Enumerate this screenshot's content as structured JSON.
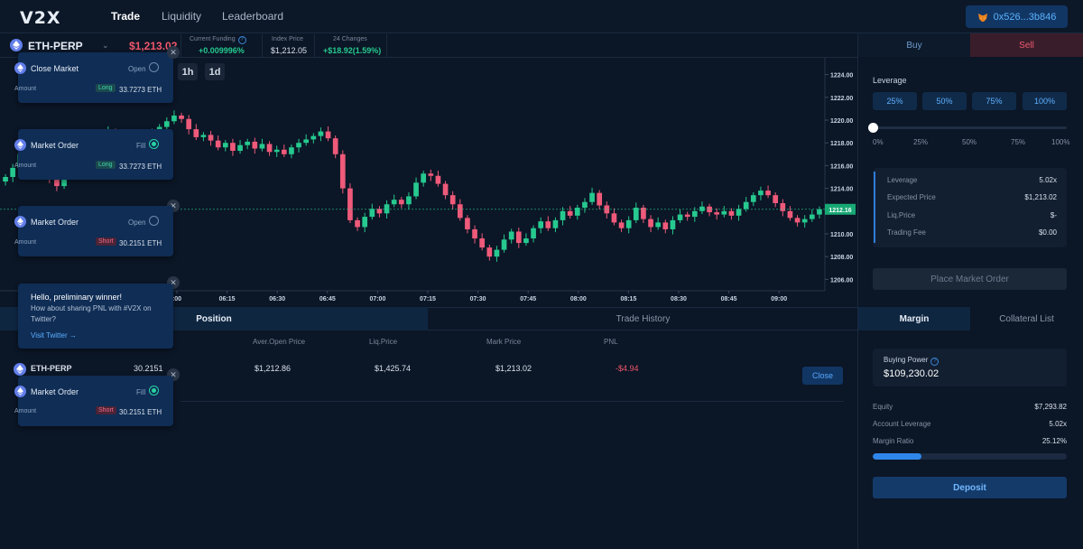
{
  "nav": {
    "logo": "V2X",
    "links": [
      "Trade",
      "Liquidity",
      "Leaderboard"
    ],
    "wallet": "0x526...3b846"
  },
  "ticker": {
    "pair": "ETH-PERP",
    "last_price": "$1,213.02",
    "funding_label": "Current Funding",
    "funding_value": "+0.009996%",
    "index_label": "Index Price",
    "index_value": "$1,212.05",
    "change_label": "24 Changes",
    "change_value": "+$18.92(1.59%)"
  },
  "timeframes": [
    "1h",
    "1d"
  ],
  "chart_data": {
    "type": "candlestick",
    "y_ticks": [
      "1224.00",
      "1222.00",
      "1220.00",
      "1218.00",
      "1216.00",
      "1214.00",
      "1212.00",
      "1210.00",
      "1208.00",
      "1206.00"
    ],
    "x_ticks": [
      ":00",
      "06:15",
      "06:30",
      "06:45",
      "07:00",
      "07:15",
      "07:30",
      "07:45",
      "08:00",
      "08:15",
      "08:30",
      "08:45",
      "09:00"
    ],
    "ylim": [
      1205,
      1225
    ],
    "current_price_label": "1212.16",
    "current_price": 1212.16,
    "closes": [
      1215.0,
      1215.8,
      1217.0,
      1218.2,
      1217.5,
      1216.0,
      1214.8,
      1214.2,
      1215.5,
      1217.2,
      1218.5,
      1218.0,
      1217.2,
      1218.6,
      1219.0,
      1218.3,
      1217.5,
      1218.0,
      1217.0,
      1218.2,
      1218.8,
      1219.4,
      1219.9,
      1220.4,
      1220.1,
      1219.2,
      1218.5,
      1218.7,
      1218.2,
      1217.6,
      1218.0,
      1217.3,
      1217.8,
      1218.1,
      1217.5,
      1217.9,
      1217.2,
      1217.4,
      1217.0,
      1217.6,
      1218.0,
      1218.3,
      1218.6,
      1219.0,
      1218.4,
      1217.0,
      1214.0,
      1211.2,
      1210.6,
      1211.5,
      1212.2,
      1211.8,
      1212.6,
      1213.0,
      1212.6,
      1213.3,
      1214.5,
      1215.3,
      1215.1,
      1214.4,
      1213.4,
      1212.6,
      1211.4,
      1210.4,
      1209.6,
      1208.8,
      1208.0,
      1208.6,
      1209.5,
      1210.2,
      1209.2,
      1209.6,
      1210.5,
      1211.1,
      1210.5,
      1211.2,
      1212.0,
      1211.6,
      1212.3,
      1212.8,
      1213.6,
      1212.5,
      1211.8,
      1211.0,
      1210.5,
      1211.2,
      1212.3,
      1211.3,
      1210.6,
      1211.0,
      1210.4,
      1211.2,
      1211.7,
      1211.5,
      1212.0,
      1212.4,
      1211.9,
      1211.7,
      1212.0,
      1211.6,
      1212.2,
      1212.8,
      1213.4,
      1213.8,
      1213.4,
      1212.7,
      1212.0,
      1211.4,
      1211.0,
      1211.3,
      1211.7,
      1212.16
    ]
  },
  "lower_tabs": [
    "Position",
    "Trade History"
  ],
  "positions": {
    "headers": [
      "Aver.Open Price",
      "Liq.Price",
      "Mark Price",
      "PNL"
    ],
    "row": {
      "pair": "ETH-PERP",
      "size": "30.2151",
      "open_price": "$1,212.86",
      "liq_price": "$1,425.74",
      "mark_price": "$1,213.02",
      "pnl": "-$4.94",
      "close": "Close"
    }
  },
  "order_panel": {
    "buy": "Buy",
    "sell": "Sell",
    "leverage_title": "Leverage",
    "leverage_buttons": [
      "25%",
      "50%",
      "75%",
      "100%"
    ],
    "slider_ticks": [
      "0%",
      "25%",
      "50%",
      "75%",
      "100%"
    ],
    "slider_value": 0,
    "summary": [
      {
        "label": "Leverage",
        "value": "5.02x"
      },
      {
        "label": "Expected Price",
        "value": "$1,213.02"
      },
      {
        "label": "Liq.Price",
        "value": "$-"
      },
      {
        "label": "Trading Fee",
        "value": "$0.00"
      }
    ],
    "place_order": "Place Market Order"
  },
  "account_panel": {
    "tabs": [
      "Margin",
      "Collateral List"
    ],
    "buying_power_label": "Buying Power",
    "buying_power": "$109,230.02",
    "rows": [
      {
        "label": "Equity",
        "value": "$7,293.82"
      },
      {
        "label": "Account Leverage",
        "value": "5.02x"
      },
      {
        "label": "Margin Ratio",
        "value": "25.12%"
      }
    ],
    "margin_ratio_fraction": 0.2512,
    "deposit": "Deposit"
  },
  "toasts": [
    {
      "title": "Close Market",
      "status": "Open",
      "amount_label": "Amount",
      "side": "Long",
      "qty": "33.7273",
      "unit": "ETH"
    },
    {
      "title": "Market Order",
      "status": "Fill",
      "amount_label": "Amount",
      "side": "Long",
      "qty": "33.7273",
      "unit": "ETH"
    },
    {
      "title": "Market Order",
      "status": "Open",
      "amount_label": "Amount",
      "side": "Short",
      "qty": "30.2151",
      "unit": "ETH"
    },
    {
      "title": "Market Order",
      "status": "Fill",
      "amount_label": "Amount",
      "side": "Short",
      "qty": "30.2151",
      "unit": "ETH"
    }
  ],
  "share_toast": {
    "title": "Hello, preliminary winner!",
    "body": "How about sharing PNL with #V2X on Twitter?",
    "link": "Visit Twitter"
  },
  "colors": {
    "up": "#26c98f",
    "down": "#ef5a7a",
    "accent": "#2f86ea"
  }
}
